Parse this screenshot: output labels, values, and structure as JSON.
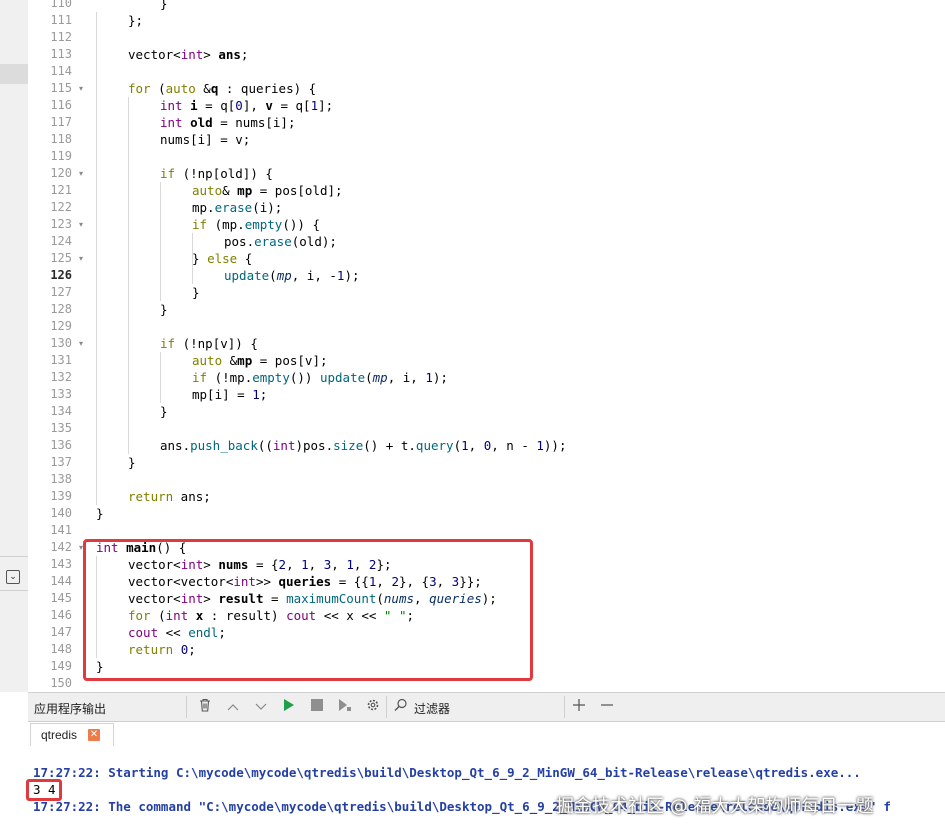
{
  "editor": {
    "current_line": 126,
    "lines": [
      {
        "n": "110",
        "fold": false,
        "indent": 2,
        "html": "}"
      },
      {
        "n": "111",
        "fold": false,
        "indent": 1,
        "html": "};"
      },
      {
        "n": "112",
        "fold": false,
        "indent": 0,
        "html": ""
      },
      {
        "n": "113",
        "fold": false,
        "indent": 1,
        "html": "vector&lt;<span class='ty'>int</span>&gt; <span class='vr'>ans</span>;"
      },
      {
        "n": "114",
        "fold": false,
        "indent": 0,
        "html": ""
      },
      {
        "n": "115",
        "fold": true,
        "indent": 1,
        "html": "<span class='kw'>for</span> (<span class='kw'>auto</span> &amp;<span class='vr'>q</span> : queries) {"
      },
      {
        "n": "116",
        "fold": false,
        "indent": 2,
        "html": "<span class='ty'>int</span> <span class='vr'>i</span> = q[<span class='nm'>0</span>], <span class='vr'>v</span> = q[<span class='nm'>1</span>];"
      },
      {
        "n": "117",
        "fold": false,
        "indent": 2,
        "html": "<span class='ty'>int</span> <span class='vr'>old</span> = nums[i];"
      },
      {
        "n": "118",
        "fold": false,
        "indent": 2,
        "html": "nums[i] = v;"
      },
      {
        "n": "119",
        "fold": false,
        "indent": 0,
        "html": ""
      },
      {
        "n": "120",
        "fold": true,
        "indent": 2,
        "html": "<span class='kw'>if</span> (!np[old]) {"
      },
      {
        "n": "121",
        "fold": false,
        "indent": 3,
        "html": "<span class='kw'>auto</span>&amp; <span class='vr'>mp</span> = pos[old];"
      },
      {
        "n": "122",
        "fold": false,
        "indent": 3,
        "html": "mp.<span class='fn'>erase</span>(i);"
      },
      {
        "n": "123",
        "fold": true,
        "indent": 3,
        "html": "<span class='kw'>if</span> (mp.<span class='fn'>empty</span>()) {"
      },
      {
        "n": "124",
        "fold": false,
        "indent": 4,
        "html": "pos.<span class='fn'>erase</span>(old);"
      },
      {
        "n": "125",
        "fold": true,
        "indent": 3,
        "html": "} <span class='kw'>else</span> {"
      },
      {
        "n": "126",
        "fold": false,
        "indent": 4,
        "html": "<span class='fn'>update</span>(<span class='pm'>mp</span>, i, -<span class='nm'>1</span>);"
      },
      {
        "n": "127",
        "fold": false,
        "indent": 3,
        "html": "}"
      },
      {
        "n": "128",
        "fold": false,
        "indent": 2,
        "html": "}"
      },
      {
        "n": "129",
        "fold": false,
        "indent": 0,
        "html": ""
      },
      {
        "n": "130",
        "fold": true,
        "indent": 2,
        "html": "<span class='kw'>if</span> (!np[v]) {"
      },
      {
        "n": "131",
        "fold": false,
        "indent": 3,
        "html": "<span class='kw'>auto</span> &amp;<span class='vr'>mp</span> = pos[v];"
      },
      {
        "n": "132",
        "fold": false,
        "indent": 3,
        "html": "<span class='kw'>if</span> (!mp.<span class='fn'>empty</span>()) <span class='fn'>update</span>(<span class='pm'>mp</span>, i, <span class='nm'>1</span>);"
      },
      {
        "n": "133",
        "fold": false,
        "indent": 3,
        "html": "mp[i] = <span class='nm'>1</span>;"
      },
      {
        "n": "134",
        "fold": false,
        "indent": 2,
        "html": "}"
      },
      {
        "n": "135",
        "fold": false,
        "indent": 0,
        "html": ""
      },
      {
        "n": "136",
        "fold": false,
        "indent": 2,
        "html": "ans.<span class='fn'>push_back</span>((<span class='ty'>int</span>)pos.<span class='fn'>size</span>() + t.<span class='fn'>query</span>(<span class='nm'>1</span>, <span class='nm'>0</span>, n - <span class='nm'>1</span>));"
      },
      {
        "n": "137",
        "fold": false,
        "indent": 1,
        "html": "}"
      },
      {
        "n": "138",
        "fold": false,
        "indent": 0,
        "html": ""
      },
      {
        "n": "139",
        "fold": false,
        "indent": 1,
        "html": "<span class='kw'>return</span> ans;"
      },
      {
        "n": "140",
        "fold": false,
        "indent": 0,
        "html": "}"
      },
      {
        "n": "141",
        "fold": false,
        "indent": 0,
        "html": ""
      },
      {
        "n": "142",
        "fold": true,
        "indent": 0,
        "html": "<span class='ty'>int</span> <span class='vr'>main</span>() {"
      },
      {
        "n": "143",
        "fold": false,
        "indent": 1,
        "html": "vector&lt;<span class='ty'>int</span>&gt; <span class='vr'>nums</span> = {<span class='nm'>2</span>, <span class='nm'>1</span>, <span class='nm'>3</span>, <span class='nm'>1</span>, <span class='nm'>2</span>};"
      },
      {
        "n": "144",
        "fold": false,
        "indent": 1,
        "html": "vector&lt;vector&lt;<span class='ty'>int</span>&gt;&gt; <span class='vr'>queries</span> = {{<span class='nm'>1</span>, <span class='nm'>2</span>}, {<span class='nm'>3</span>, <span class='nm'>3</span>}};"
      },
      {
        "n": "145",
        "fold": false,
        "indent": 1,
        "html": "vector&lt;<span class='ty'>int</span>&gt; <span class='vr'>result</span> = <span class='fn'>maximumCount</span>(<span class='pm'>nums</span>, <span class='pm'>queries</span>);"
      },
      {
        "n": "146",
        "fold": false,
        "indent": 1,
        "html": "<span class='kw'>for</span> (<span class='ty'>int</span> <span class='vr'>x</span> : result) <span class='ty'>cout</span> &lt;&lt; x &lt;&lt; <span class='st'>\" \"</span>;"
      },
      {
        "n": "147",
        "fold": false,
        "indent": 1,
        "html": "<span class='ty'>cout</span> &lt;&lt; <span class='fn'>endl</span>;"
      },
      {
        "n": "148",
        "fold": false,
        "indent": 1,
        "html": "<span class='kw'>return</span> <span class='nm'>0</span>;"
      },
      {
        "n": "149",
        "fold": false,
        "indent": 0,
        "html": "}"
      },
      {
        "n": "150",
        "fold": false,
        "indent": 0,
        "html": ""
      }
    ]
  },
  "output_pane": {
    "title": "应用程序输出",
    "filter_label": "过滤器",
    "tab_label": "qtredis",
    "tab_close": "✕",
    "lines": [
      {
        "text": "17:27:22: Starting C:\\mycode\\mycode\\qtredis\\build\\Desktop_Qt_6_9_2_MinGW_64_bit-Release\\release\\qtredis.exe...",
        "style": "blue"
      },
      {
        "text": "3 4",
        "style": "plain"
      },
      {
        "text": "17:27:22: The command \"C:\\mycode\\mycode\\qtredis\\build\\Desktop_Qt_6_9_2_MinGW_64_bit-Release\\release\\qtredis.exe\" f",
        "style": "blue"
      }
    ]
  },
  "toolbar_icons": [
    "trash-icon",
    "arrow-up-icon",
    "arrow-down-icon",
    "run-icon",
    "stop-icon",
    "run-debug-icon",
    "gear-icon",
    "search-icon",
    "plus-icon",
    "minus-icon"
  ],
  "watermark": "掘金技术社区 @ 福大大架构师每日一题",
  "colors": {
    "highlight_border": "#e0393e",
    "keyword": "#808000",
    "type": "#800080",
    "number": "#000080",
    "output_blue": "#2440a4"
  }
}
